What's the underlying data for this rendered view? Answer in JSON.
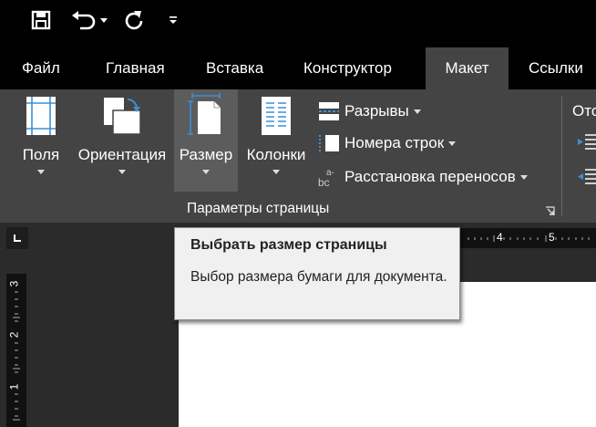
{
  "quick_access": {
    "save_icon": "save-icon",
    "undo_icon": "undo-icon",
    "redo_icon": "redo-icon",
    "customize_icon": "customize-qat-icon"
  },
  "tabs": [
    {
      "label": "Файл"
    },
    {
      "label": "Главная"
    },
    {
      "label": "Вставка"
    },
    {
      "label": "Конструктор"
    },
    {
      "label": "Макет",
      "active": true
    },
    {
      "label": "Ссылки"
    }
  ],
  "ribbon": {
    "buttons": {
      "margins": "Поля",
      "orientation": "Ориентация",
      "size": "Размер",
      "columns": "Колонки"
    },
    "small_buttons": {
      "breaks": "Разрывы",
      "line_numbers": "Номера строк",
      "hyphenation": "Расстановка переносов"
    },
    "group_label": "Параметры страницы",
    "next_group_partial": "Отс"
  },
  "ruler": {
    "h_marks": [
      "4",
      "5"
    ],
    "v_marks": [
      "3",
      "2",
      "1"
    ]
  },
  "tooltip": {
    "title": "Выбрать размер страницы",
    "description": "Выбор размера бумаги для документа."
  },
  "colors": {
    "ribbon_bg": "#444444",
    "tab_active_bg": "#444444",
    "accent_blue": "#3b8fd6"
  }
}
